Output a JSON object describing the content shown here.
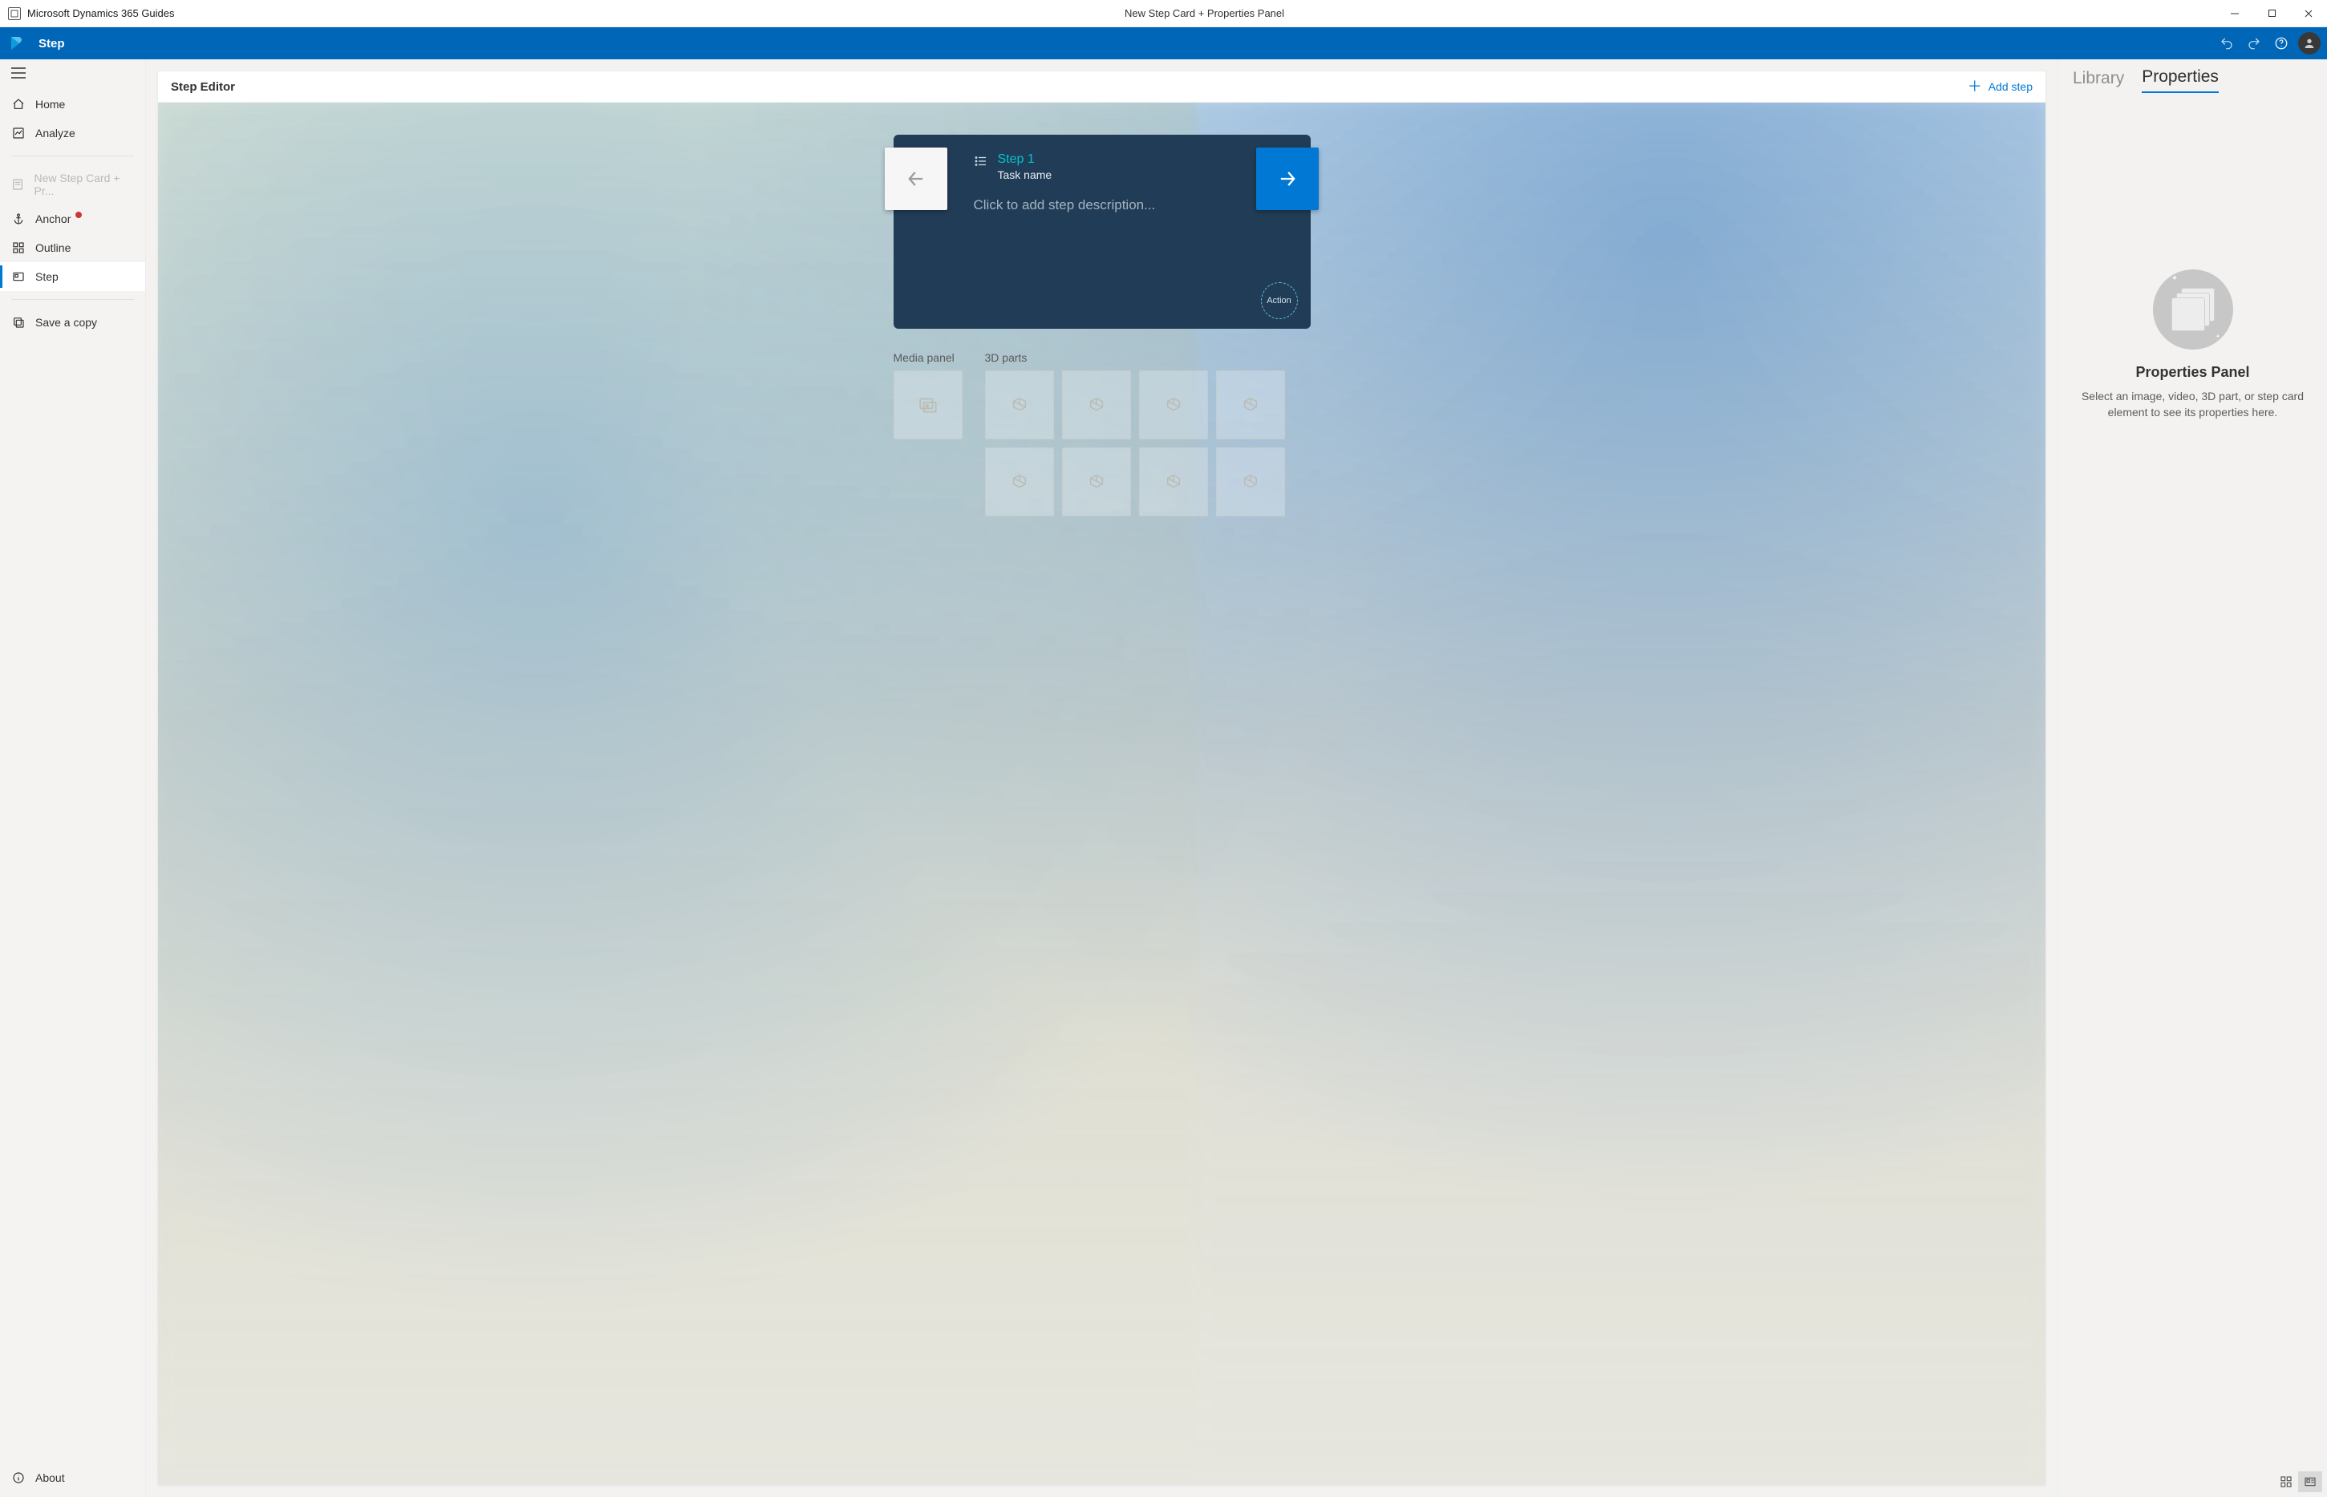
{
  "window": {
    "app_title": "Microsoft Dynamics 365 Guides",
    "doc_title": "New Step Card + Properties Panel"
  },
  "ribbon": {
    "page": "Step"
  },
  "sidebar": {
    "home": "Home",
    "analyze": "Analyze",
    "recent": "New Step Card + Pr...",
    "anchor": "Anchor",
    "outline": "Outline",
    "step": "Step",
    "save_copy": "Save a copy",
    "about": "About"
  },
  "editor": {
    "title": "Step Editor",
    "add_step": "Add step",
    "step_label": "Step 1",
    "task_label": "Task name",
    "desc_placeholder": "Click to add step description...",
    "action_label": "Action",
    "media_label": "Media panel",
    "parts_label": "3D parts"
  },
  "right_panel": {
    "tab_library": "Library",
    "tab_properties": "Properties",
    "empty_title": "Properties Panel",
    "empty_desc": "Select an image, video, 3D part, or step card element to see its properties here."
  }
}
